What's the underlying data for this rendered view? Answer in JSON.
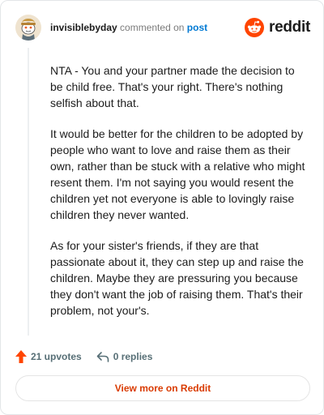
{
  "header": {
    "username": "invisiblebyday",
    "action_text": "commented on",
    "post_link": "post",
    "logo_word": "reddit",
    "avatar_icon": "snoo-avatar-icon",
    "logo_icon": "reddit-snoo-icon"
  },
  "comment": {
    "paragraphs": [
      "NTA - You and your partner made the decision to be child free. That's your right. There's nothing selfish about that.",
      "It would be better for the children to be adopted by people who want to love and raise them as their own, rather than be stuck with a relative who might resent them. I'm not saying you would resent the children yet not everyone is able to lovingly raise children they never wanted.",
      "As for your sister's friends, if they are that passionate about it, they can step up and raise the children. Maybe they are pressuring you because they don't want the job of raising them. That's their problem, not your's."
    ]
  },
  "actions": {
    "upvotes": "21 upvotes",
    "replies": "0 replies",
    "upvote_icon": "upvote-arrow-icon",
    "reply_icon": "reply-arrow-icon"
  },
  "footer": {
    "button_label": "View more on Reddit"
  },
  "colors": {
    "brand": "#ff4500",
    "link": "#0079d3",
    "button_text": "#d93a00",
    "muted": "#576f76"
  }
}
